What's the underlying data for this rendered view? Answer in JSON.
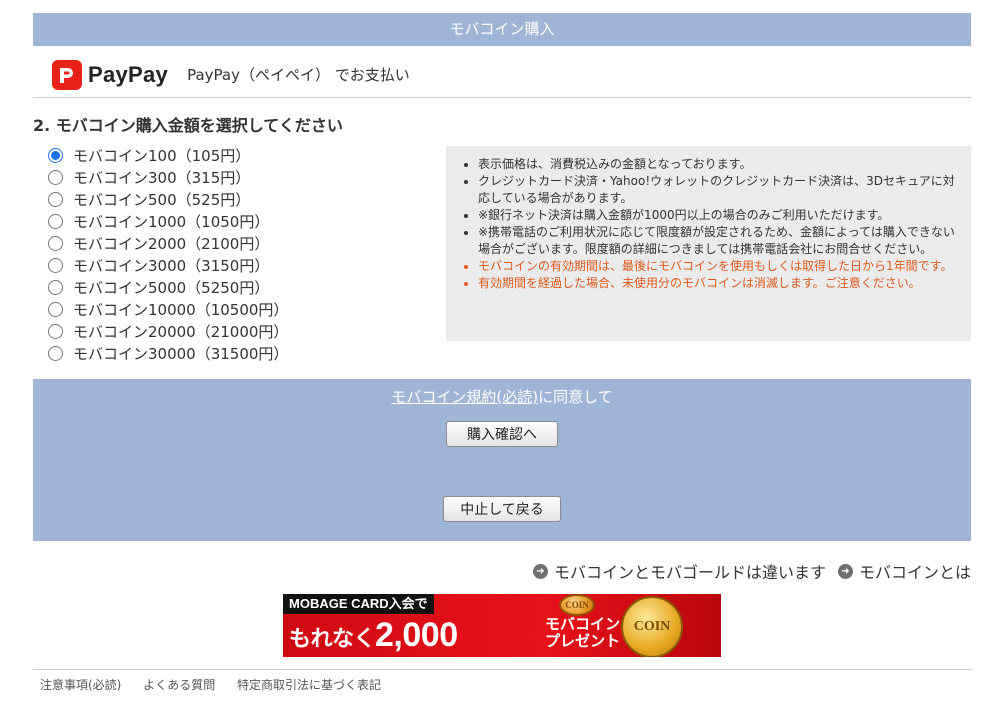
{
  "header": {
    "title": "モバコイン購入"
  },
  "payment": {
    "logo_text": "PayPay",
    "description": "PayPay（ペイペイ） でお支払い",
    "brand_color": "#e8211a"
  },
  "section": {
    "title": "2.  モバコイン購入金額を選択してください"
  },
  "options": [
    {
      "label": "モバコイン100（105円）",
      "checked": true
    },
    {
      "label": "モバコイン300（315円）",
      "checked": false
    },
    {
      "label": "モバコイン500（525円）",
      "checked": false
    },
    {
      "label": "モバコイン1000（1050円）",
      "checked": false
    },
    {
      "label": "モバコイン2000（2100円）",
      "checked": false
    },
    {
      "label": "モバコイン3000（3150円）",
      "checked": false
    },
    {
      "label": "モバコイン5000（5250円）",
      "checked": false
    },
    {
      "label": "モバコイン10000（10500円）",
      "checked": false
    },
    {
      "label": "モバコイン20000（21000円）",
      "checked": false
    },
    {
      "label": "モバコイン30000（31500円）",
      "checked": false
    }
  ],
  "notes": [
    {
      "text": "表示価格は、消費税込みの金額となっております。",
      "warn": false
    },
    {
      "text": "クレジットカード決済・Yahoo!ウォレットのクレジットカード決済は、3Dセキュアに対応している場合があります。",
      "warn": false
    },
    {
      "text": "※銀行ネット決済は購入金額が1000円以上の場合のみご利用いただけます。",
      "warn": false
    },
    {
      "text": "※携帯電話のご利用状況に応じて限度額が設定されるため、金額によっては購入できない場合がございます。限度額の詳細につきましては携帯電話会社にお問合せください。",
      "warn": false
    },
    {
      "text": "モバコインの有効期間は、最後にモバコインを使用もしくは取得した日から1年間です。",
      "warn": true
    },
    {
      "text": "有効期間を経過した場合、未使用分のモバコインは消滅します。ご注意ください。",
      "warn": true
    }
  ],
  "agree": {
    "link_text": "モバコイン規約(必読)",
    "suffix": "に同意して",
    "confirm_label": "購入確認へ",
    "cancel_label": "中止して戻る"
  },
  "links": [
    {
      "label": "モバコインとモバゴールドは違います",
      "icon": "arrow-circle-icon"
    },
    {
      "label": "モバコインとは",
      "icon": "arrow-circle-icon"
    }
  ],
  "banner": {
    "top_text": "MOBAGE CARD入会で",
    "main_prefix": "もれなく",
    "main_amount": "2,000",
    "side_line1": "モバコイン",
    "side_line2": "プレゼント",
    "coin_text": "COIN",
    "small_coin_text": "COIN"
  },
  "footer": {
    "items": [
      "注意事項(必読)",
      "よくある質問",
      "特定商取引法に基づく表記"
    ]
  },
  "colors": {
    "panel_blue": "#9fb5d6",
    "notes_bg": "#ebebeb",
    "warn_orange": "#e05a1c"
  }
}
